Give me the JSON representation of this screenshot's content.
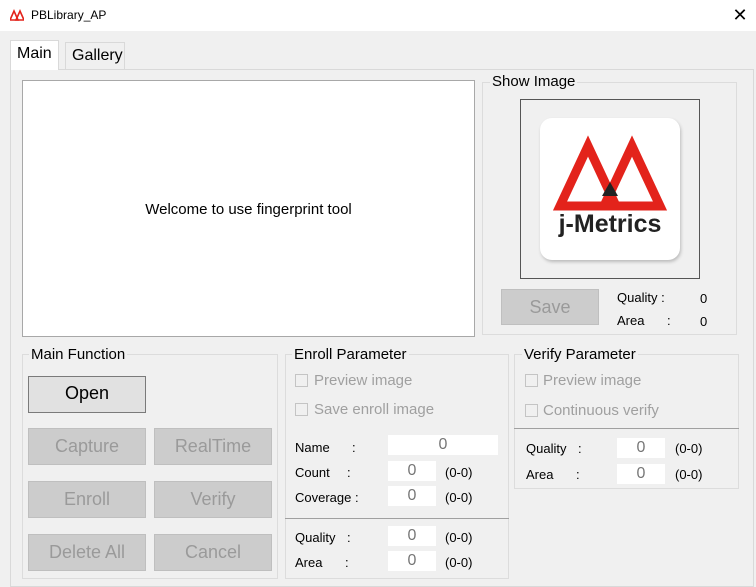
{
  "window": {
    "title": "PBLibrary_AP",
    "close_glyph": "✕"
  },
  "tabs": [
    {
      "label": "Main"
    },
    {
      "label": "Gallery"
    }
  ],
  "main": {
    "welcome_text": "Welcome to use fingerprint tool"
  },
  "show_image": {
    "title": "Show Image",
    "logo_text": "j-Metrics",
    "save_label": "Save",
    "quality_label": "Quality :",
    "quality_value": "0",
    "area_label": "Area",
    "area_colon": ":",
    "area_value": "0",
    "logo_red": "#e3231b"
  },
  "main_function": {
    "title": "Main Function",
    "open_label": "Open",
    "capture_label": "Capture",
    "realtime_label": "RealTime",
    "enroll_label": "Enroll",
    "verify_label": "Verify",
    "delete_all_label": "Delete All",
    "cancel_label": "Cancel"
  },
  "enroll_parameter": {
    "title": "Enroll Parameter",
    "preview_label": "Preview image",
    "save_enroll_label": "Save enroll image",
    "name_label": "Name",
    "name_colon": ":",
    "name_value": "0",
    "count_label": "Count",
    "count_colon": ":",
    "count_value": "0",
    "count_range": "(0-0)",
    "coverage_label": "Coverage :",
    "coverage_value": "0",
    "coverage_range": "(0-0)",
    "quality_label": "Quality",
    "quality_colon": ":",
    "quality_value": "0",
    "quality_range": "(0-0)",
    "area_label": "Area",
    "area_colon": ":",
    "area_value": "0",
    "area_range": "(0-0)"
  },
  "verify_parameter": {
    "title": "Verify Parameter",
    "preview_label": "Preview image",
    "continuous_label": "Continuous verify",
    "quality_label": "Quality",
    "quality_colon": ":",
    "quality_value": "0",
    "quality_range": "(0-0)",
    "area_label": "Area",
    "area_colon": ":",
    "area_value": "0",
    "area_range": "(0-0)"
  }
}
